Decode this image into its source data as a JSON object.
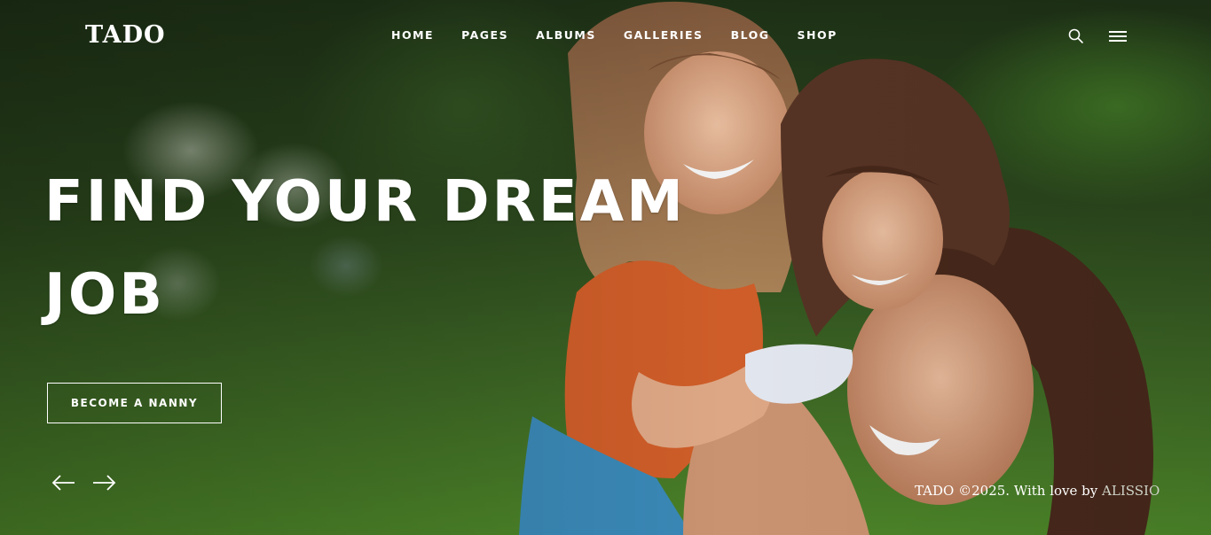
{
  "brand": {
    "logo": "TADO"
  },
  "nav": {
    "items": [
      {
        "label": "HOME"
      },
      {
        "label": "PAGES"
      },
      {
        "label": "ALBUMS"
      },
      {
        "label": "GALLERIES"
      },
      {
        "label": "BLOG"
      },
      {
        "label": "SHOP"
      }
    ]
  },
  "header": {
    "search_icon": "search-icon",
    "menu_icon": "hamburger-menu-icon"
  },
  "hero": {
    "headline_line1": "FIND YOUR DREAM",
    "headline_line2": "JOB",
    "cta_label": "BECOME A NANNY",
    "prev_icon": "arrow-left-icon",
    "next_icon": "arrow-right-icon"
  },
  "footer": {
    "credit_prefix": "TADO ©2025. With love by ",
    "credit_author": "ALISSIO"
  },
  "colors": {
    "text": "#ffffff",
    "accent_green": "#4f8a2a",
    "dark_green": "#1f3317"
  }
}
